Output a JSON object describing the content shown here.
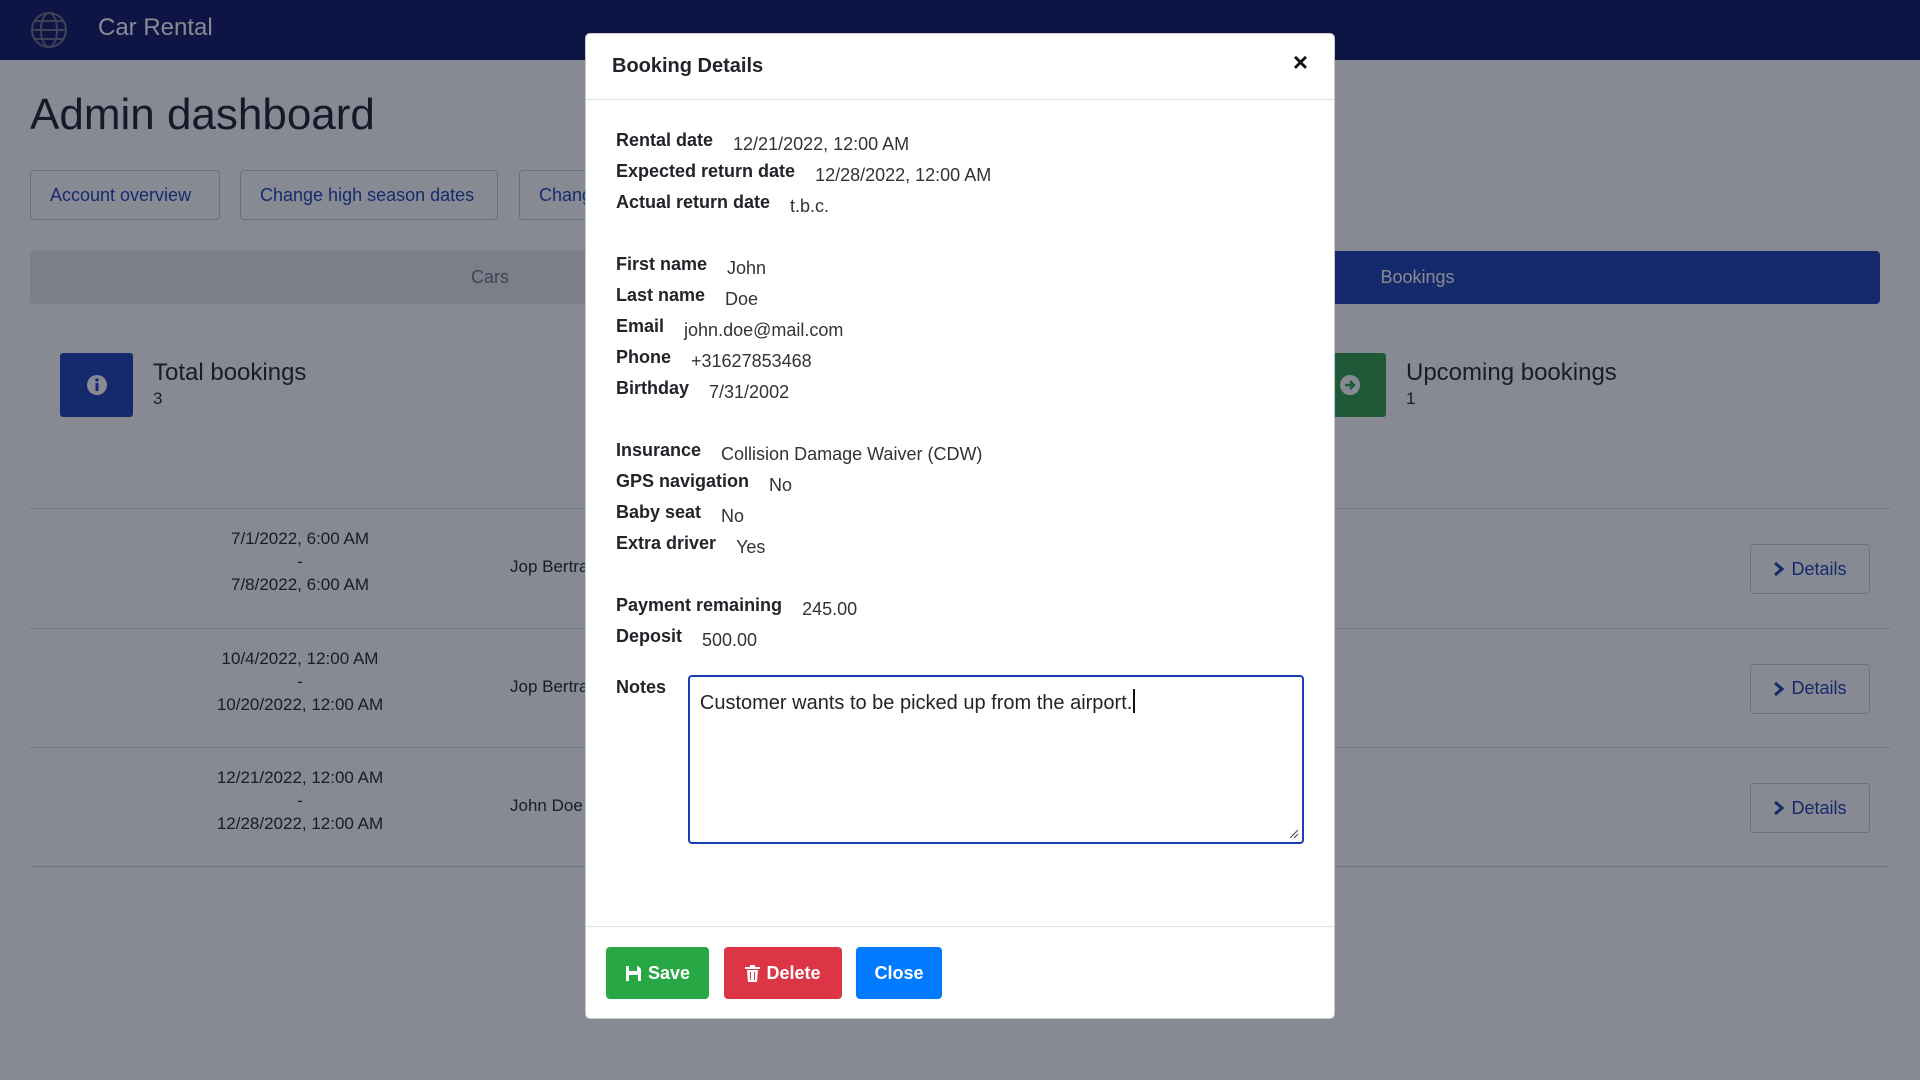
{
  "nav": {
    "brand": "Car Rental",
    "logo_icon": "globe-icon"
  },
  "page": {
    "title": "Admin dashboard"
  },
  "toolbar": {
    "buttons": [
      "Account overview",
      "Change high season dates",
      "Chang"
    ]
  },
  "tabs": {
    "cars": "Cars",
    "bookings": "Bookings",
    "active": "Bookings"
  },
  "stats": {
    "total": {
      "label": "Total bookings",
      "count": "3",
      "color": "#1a3fb0",
      "icon": "info-icon"
    },
    "upcoming": {
      "label": "Upcoming bookings",
      "count": "1",
      "color": "#2e9c46",
      "icon": "arrow-circle-icon"
    }
  },
  "bookings": [
    {
      "start": "7/1/2022, 6:00 AM",
      "sep": "-",
      "end": "7/8/2022, 6:00 AM",
      "name": "Jop Bertra",
      "details": "Details"
    },
    {
      "start": "10/4/2022, 12:00 AM",
      "sep": "-",
      "end": "10/20/2022, 12:00 AM",
      "name": "Jop Bertra",
      "details": "Details"
    },
    {
      "start": "12/21/2022, 12:00 AM",
      "sep": "-",
      "end": "12/28/2022, 12:00 AM",
      "name": "John Doe",
      "details": "Details"
    }
  ],
  "modal": {
    "title": "Booking Details",
    "close_symbol": "×",
    "dates": [
      {
        "label": "Rental date",
        "value": "12/21/2022, 12:00 AM"
      },
      {
        "label": "Expected return date",
        "value": "12/28/2022, 12:00 AM"
      },
      {
        "label": "Actual return date",
        "value": "t.b.c."
      }
    ],
    "customer": [
      {
        "label": "First name",
        "value": "John"
      },
      {
        "label": "Last name",
        "value": "Doe"
      },
      {
        "label": "Email",
        "value": "john.doe@mail.com"
      },
      {
        "label": "Phone",
        "value": "+31627853468"
      },
      {
        "label": "Birthday",
        "value": "7/31/2002"
      }
    ],
    "extras": [
      {
        "label": "Insurance",
        "value": "Collision Damage Waiver (CDW)"
      },
      {
        "label": "GPS navigation",
        "value": "No"
      },
      {
        "label": "Baby seat",
        "value": "No"
      },
      {
        "label": "Extra driver",
        "value": "Yes"
      }
    ],
    "payment": [
      {
        "label": "Payment remaining",
        "value": "245.00"
      },
      {
        "label": "Deposit",
        "value": "500.00"
      }
    ],
    "notes": {
      "label": "Notes",
      "value": "Customer wants to be picked up from the airport."
    },
    "buttons": {
      "save": "Save",
      "delete": "Delete",
      "close": "Close"
    }
  }
}
